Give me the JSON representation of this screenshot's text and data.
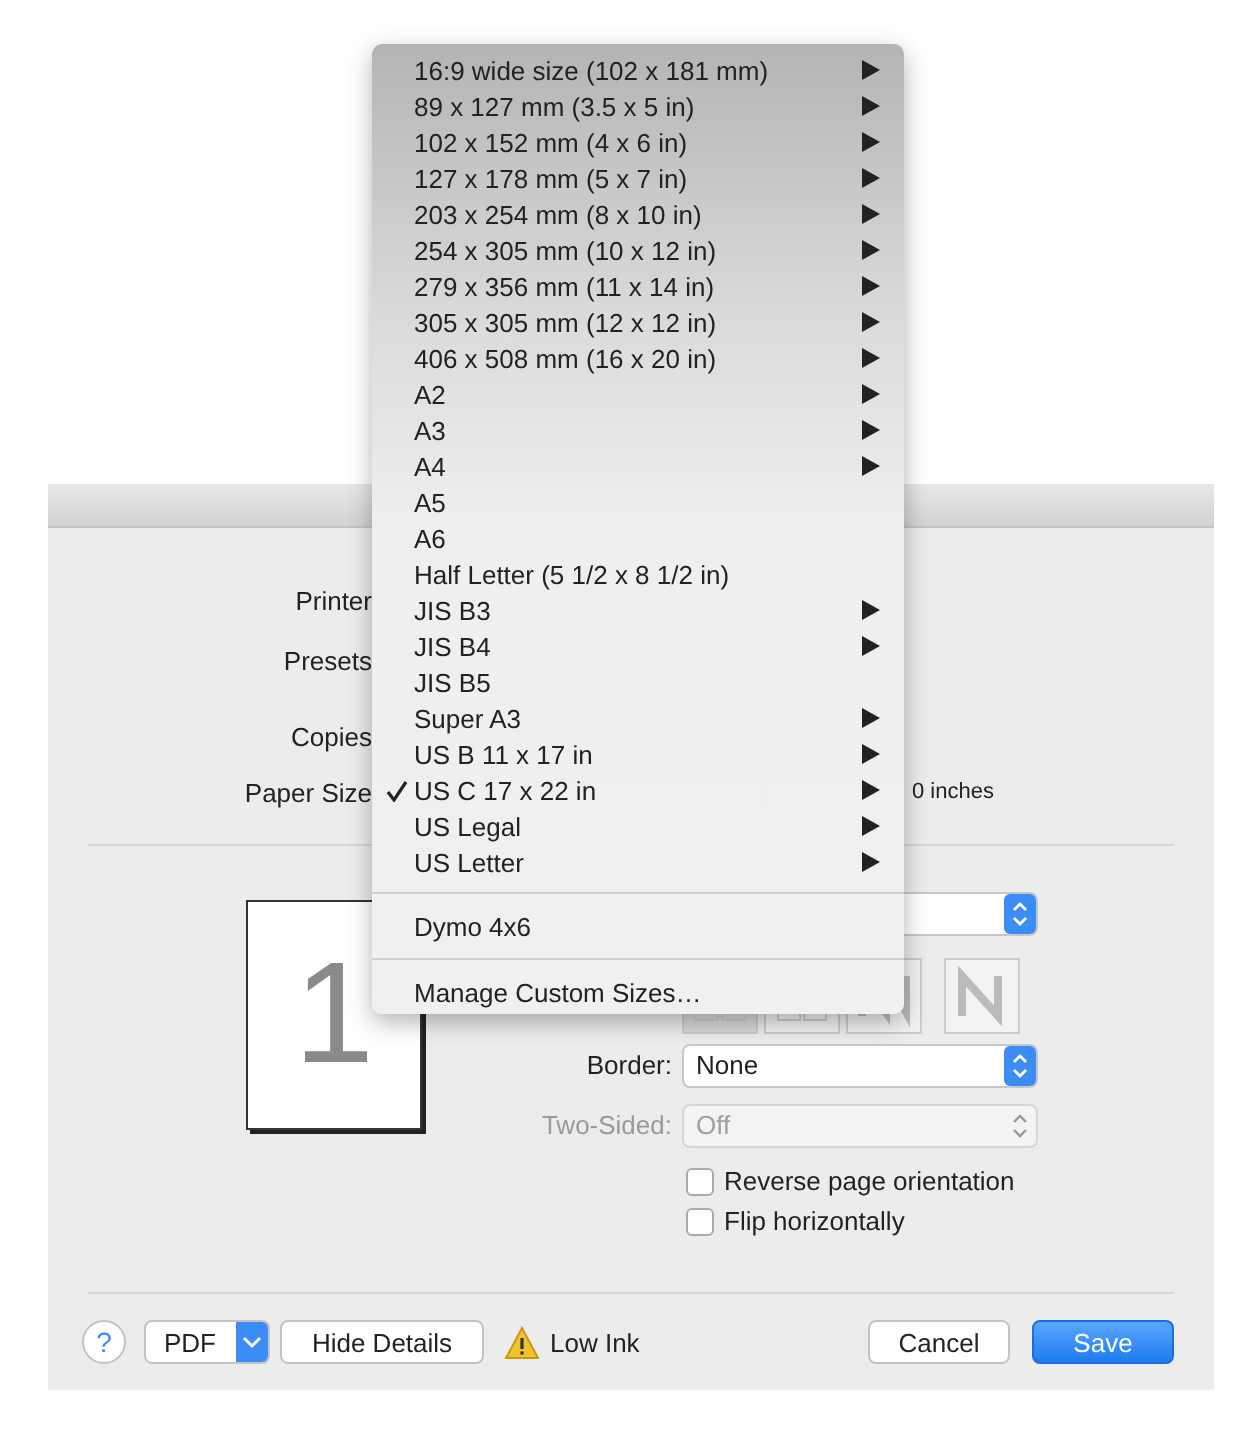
{
  "dialog": {
    "fields": [
      {
        "label": "Printer"
      },
      {
        "label": "Presets"
      },
      {
        "label": "Copies"
      },
      {
        "label": "Paper Size"
      }
    ],
    "paper_size_note": "0 inches",
    "preview_page": "1",
    "border": {
      "label": "Border:",
      "value": "None",
      "disabled": false
    },
    "two_sided": {
      "label": "Two-Sided:",
      "value": "Off",
      "disabled": true
    },
    "checkboxes": [
      {
        "label": "Reverse page orientation",
        "checked": false
      },
      {
        "label": "Flip horizontally",
        "checked": false
      }
    ],
    "footer": {
      "help": "?",
      "pdf": "PDF",
      "hide_details": "Hide Details",
      "status": "Low Ink",
      "cancel": "Cancel",
      "save": "Save"
    }
  },
  "menu": {
    "items": [
      {
        "label": "16:9 wide size (102 x 181 mm)",
        "submenu": true,
        "checked": false
      },
      {
        "label": "89 x 127 mm (3.5 x 5 in)",
        "submenu": true,
        "checked": false
      },
      {
        "label": "102 x 152 mm (4 x 6 in)",
        "submenu": true,
        "checked": false
      },
      {
        "label": "127 x 178 mm (5 x 7 in)",
        "submenu": true,
        "checked": false
      },
      {
        "label": "203 x 254 mm (8 x 10 in)",
        "submenu": true,
        "checked": false
      },
      {
        "label": "254 x 305 mm (10 x 12 in)",
        "submenu": true,
        "checked": false
      },
      {
        "label": "279 x 356 mm (11 x 14 in)",
        "submenu": true,
        "checked": false
      },
      {
        "label": "305 x 305 mm (12 x 12 in)",
        "submenu": true,
        "checked": false
      },
      {
        "label": "406 x 508 mm (16 x 20 in)",
        "submenu": true,
        "checked": false
      },
      {
        "label": "A2",
        "submenu": true,
        "checked": false
      },
      {
        "label": "A3",
        "submenu": true,
        "checked": false
      },
      {
        "label": "A4",
        "submenu": true,
        "checked": false
      },
      {
        "label": "A5",
        "submenu": false,
        "checked": false
      },
      {
        "label": "A6",
        "submenu": false,
        "checked": false
      },
      {
        "label": "Half Letter (5 1/2 x 8 1/2 in)",
        "submenu": false,
        "checked": false
      },
      {
        "label": "JIS B3",
        "submenu": true,
        "checked": false
      },
      {
        "label": "JIS B4",
        "submenu": true,
        "checked": false
      },
      {
        "label": "JIS B5",
        "submenu": false,
        "checked": false
      },
      {
        "label": "Super A3",
        "submenu": true,
        "checked": false
      },
      {
        "label": "US B 11 x 17 in",
        "submenu": true,
        "checked": false
      },
      {
        "label": "US C 17 x 22 in",
        "submenu": true,
        "checked": true
      },
      {
        "label": "US Legal",
        "submenu": true,
        "checked": false
      },
      {
        "label": "US Letter",
        "submenu": true,
        "checked": false
      }
    ],
    "custom": [
      {
        "label": "Dymo 4x6"
      }
    ],
    "manage": {
      "label": "Manage Custom Sizes…"
    }
  }
}
